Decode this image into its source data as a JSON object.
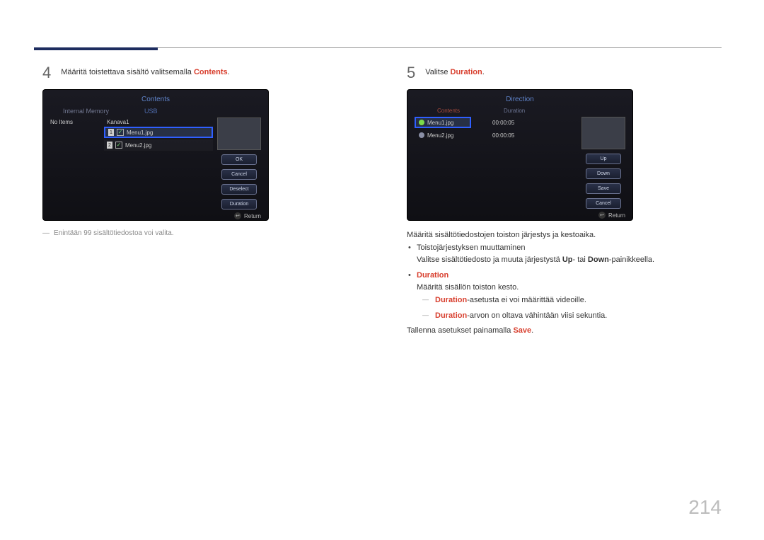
{
  "page_number": "214",
  "step4": {
    "num": "4",
    "text_before": "Määritä toistettava sisältö valitsemalla ",
    "text_key": "Contents",
    "text_after": ".",
    "device": {
      "title": "Contents",
      "tab_left": "Internal Memory",
      "tab_right": "USB",
      "no_items": "No Items",
      "channel": "Kanava1",
      "file1_idx": "1",
      "file1_name": "Menu1.jpg",
      "file2_idx": "2",
      "file2_name": "Menu2.jpg",
      "check": "✓",
      "buttons": {
        "ok": "OK",
        "cancel": "Cancel",
        "deselect": "Deselect",
        "duration": "Duration"
      },
      "return": "Return"
    },
    "note": "Enintään 99 sisältötiedostoa voi valita."
  },
  "step5": {
    "num": "5",
    "text_before": "Valitse ",
    "text_key": "Duration",
    "text_after": ".",
    "device": {
      "title": "Direction",
      "tab_left": "Contents",
      "tab_right": "Duration",
      "file1_name": "Menu1.jpg",
      "file1_dur": "00:00:05",
      "file2_name": "Menu2.jpg",
      "file2_dur": "00:00:05",
      "buttons": {
        "up": "Up",
        "down": "Down",
        "save": "Save",
        "cancel": "Cancel"
      },
      "return": "Return"
    },
    "para1": "Määritä sisältötiedostojen toiston järjestys ja kestoaika.",
    "bullet1_title": "Toistojärjestyksen muuttaminen",
    "bullet1_line_a": "Valitse sisältötiedosto ja muuta järjestystä ",
    "bullet1_up": "Up",
    "bullet1_mid": "- tai ",
    "bullet1_down": "Down",
    "bullet1_end": "-painikkeella.",
    "bullet2_title": "Duration",
    "bullet2_line": "Määritä sisällön toiston kesto.",
    "dash1_key": "Duration",
    "dash1_rest": "-asetusta ei voi määrittää videoille.",
    "dash2_key": "Duration",
    "dash2_rest": "-arvon on oltava vähintään viisi sekuntia.",
    "para2_a": "Tallenna asetukset painamalla ",
    "para2_key": "Save",
    "para2_b": "."
  },
  "return_glyph": "↩"
}
